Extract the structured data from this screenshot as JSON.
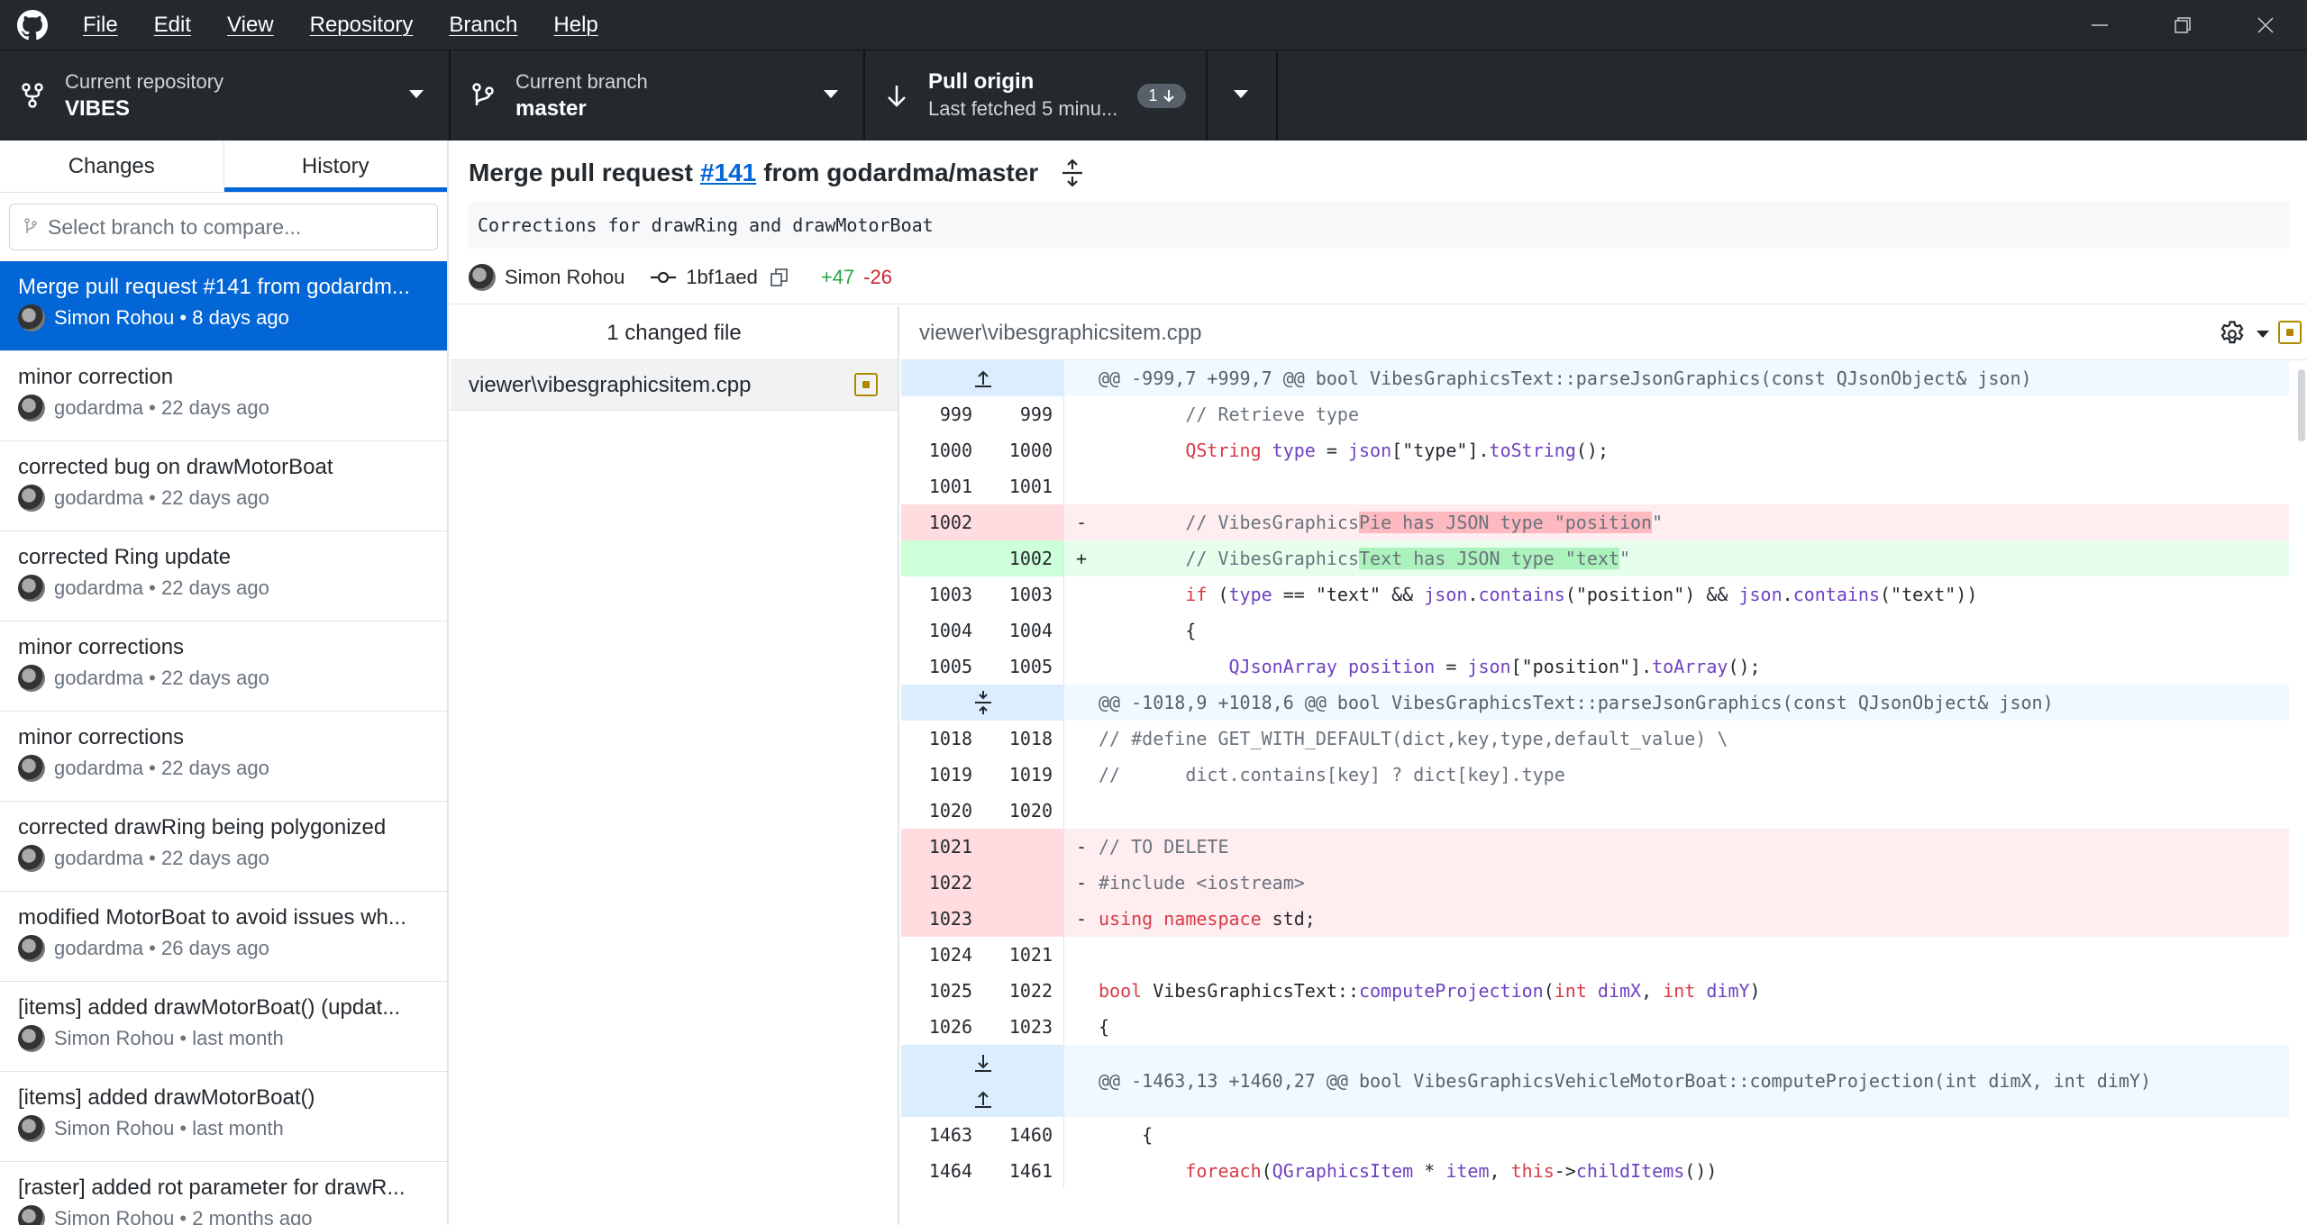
{
  "menu": [
    "File",
    "Edit",
    "View",
    "Repository",
    "Branch",
    "Help"
  ],
  "toolbar": {
    "repo_label": "Current repository",
    "repo_value": "VIBES",
    "branch_label": "Current branch",
    "branch_value": "master",
    "pull_label": "Pull origin",
    "pull_sub": "Last fetched 5 minu...",
    "pull_badge": "1"
  },
  "tabs": {
    "changes": "Changes",
    "history": "History"
  },
  "compare_placeholder": "Select branch to compare...",
  "commits": [
    {
      "title": "Merge pull request #141 from godardm...",
      "meta": "Simon Rohou • 8 days ago"
    },
    {
      "title": "minor correction",
      "meta": "godardma • 22 days ago"
    },
    {
      "title": "corrected bug on drawMotorBoat",
      "meta": "godardma • 22 days ago"
    },
    {
      "title": "corrected Ring update",
      "meta": "godardma • 22 days ago"
    },
    {
      "title": "minor corrections",
      "meta": "godardma • 22 days ago"
    },
    {
      "title": "minor corrections",
      "meta": "godardma • 22 days ago"
    },
    {
      "title": "corrected drawRing being polygonized",
      "meta": "godardma • 22 days ago"
    },
    {
      "title": "modified MotorBoat to avoid issues wh...",
      "meta": "godardma • 26 days ago"
    },
    {
      "title": "[items] added drawMotorBoat() (updat...",
      "meta": "Simon Rohou • last month"
    },
    {
      "title": "[items] added drawMotorBoat()",
      "meta": "Simon Rohou • last month"
    },
    {
      "title": "[raster] added rot parameter for drawR...",
      "meta": "Simon Rohou • 2 months ago"
    }
  ],
  "commit": {
    "title_pre": "Merge pull request",
    "title_link": "#141",
    "title_post": "from godardma/master",
    "description": "Corrections for drawRing and drawMotorBoat",
    "author": "Simon Rohou",
    "sha": "1bf1aed",
    "additions": "+47",
    "deletions": "-26"
  },
  "files": {
    "header": "1 changed file",
    "items": [
      "viewer\\vibesgraphicsitem.cpp"
    ]
  },
  "diff": {
    "filename": "viewer\\vibesgraphicsitem.cpp",
    "hunks": [
      "@@ -999,7 +999,7 @@ bool VibesGraphicsText::parseJsonGraphics(const QJsonObject& json)",
      "@@ -1018,9 +1018,6 @@ bool VibesGraphicsText::parseJsonGraphics(const QJsonObject& json)",
      "@@ -1463,13 +1460,27 @@ bool VibesGraphicsVehicleMotorBoat::computeProjection(int dimX, int dimY)"
    ],
    "line_numbers": {
      "r999": [
        "999",
        "999"
      ],
      "r1000": [
        "1000",
        "1000"
      ],
      "r1001": [
        "1001",
        "1001"
      ],
      "r1002d": [
        "1002",
        ""
      ],
      "r1002a": [
        "",
        "1002"
      ],
      "r1003": [
        "1003",
        "1003"
      ],
      "r1004": [
        "1004",
        "1004"
      ],
      "r1005": [
        "1005",
        "1005"
      ],
      "r1018": [
        "1018",
        "1018"
      ],
      "r1019": [
        "1019",
        "1019"
      ],
      "r1020": [
        "1020",
        "1020"
      ],
      "r1021": [
        "1021",
        ""
      ],
      "r1022": [
        "1022",
        ""
      ],
      "r1023": [
        "1023",
        ""
      ],
      "r1024": [
        "1024",
        "1021"
      ],
      "r1025": [
        "1025",
        "1022"
      ],
      "r1026": [
        "1026",
        "1023"
      ],
      "r1463": [
        "1463",
        "1460"
      ],
      "r1464": [
        "1464",
        "1461"
      ]
    }
  }
}
